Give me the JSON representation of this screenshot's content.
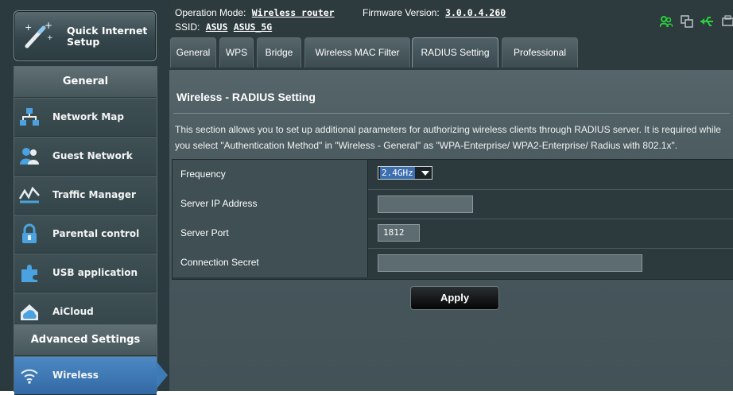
{
  "sidebar": {
    "quick_setup_label": "Quick Internet Setup",
    "general_title": "General",
    "items": [
      {
        "label": "Network Map",
        "icon": "network-map-icon"
      },
      {
        "label": "Guest Network",
        "icon": "guest-network-icon"
      },
      {
        "label": "Traffic Manager",
        "icon": "traffic-manager-icon"
      },
      {
        "label": "Parental control",
        "icon": "parental-control-icon"
      },
      {
        "label": "USB application",
        "icon": "usb-application-icon"
      },
      {
        "label": "AiCloud",
        "icon": "aicloud-icon"
      }
    ],
    "advanced_title": "Advanced Settings",
    "advanced_items": [
      {
        "label": "Wireless",
        "icon": "wireless-icon",
        "active": true
      }
    ]
  },
  "header": {
    "op_mode_label": "Operation Mode:",
    "op_mode_value": "Wireless router",
    "firmware_label": "Firmware Version:",
    "firmware_value": "3.0.0.4.260",
    "ssid_label": "SSID:",
    "ssid_1": "ASUS",
    "ssid_2": "ASUS_5G",
    "status_icons": [
      "clients-icon",
      "network-status-icon",
      "usb-status-icon",
      "printer-icon"
    ]
  },
  "tabs": [
    {
      "label": "General"
    },
    {
      "label": "WPS"
    },
    {
      "label": "Bridge"
    },
    {
      "label": "Wireless MAC Filter"
    },
    {
      "label": "RADIUS Setting",
      "active": true
    },
    {
      "label": "Professional"
    }
  ],
  "page": {
    "title": "Wireless - RADIUS Setting",
    "desc_line1": "This section allows you to set up additional parameters for authorizing wireless clients through RADIUS server. It is required while",
    "desc_line2": "you select \"Authentication Method\" in \"Wireless - General\" as \"WPA-Enterprise/ WPA2-Enterprise/ Radius with 802.1x\"."
  },
  "form": {
    "frequency_label": "Frequency",
    "frequency_value": "2.4GHz",
    "server_ip_label": "Server IP Address",
    "server_ip_value": "",
    "server_port_label": "Server Port",
    "server_port_value": "1812",
    "secret_label": "Connection Secret",
    "secret_value": ""
  },
  "apply_label": "Apply",
  "colors": {
    "accent": "#3e7ab6",
    "panel": "#2b3a3e",
    "status_green": "#2bd03c"
  }
}
